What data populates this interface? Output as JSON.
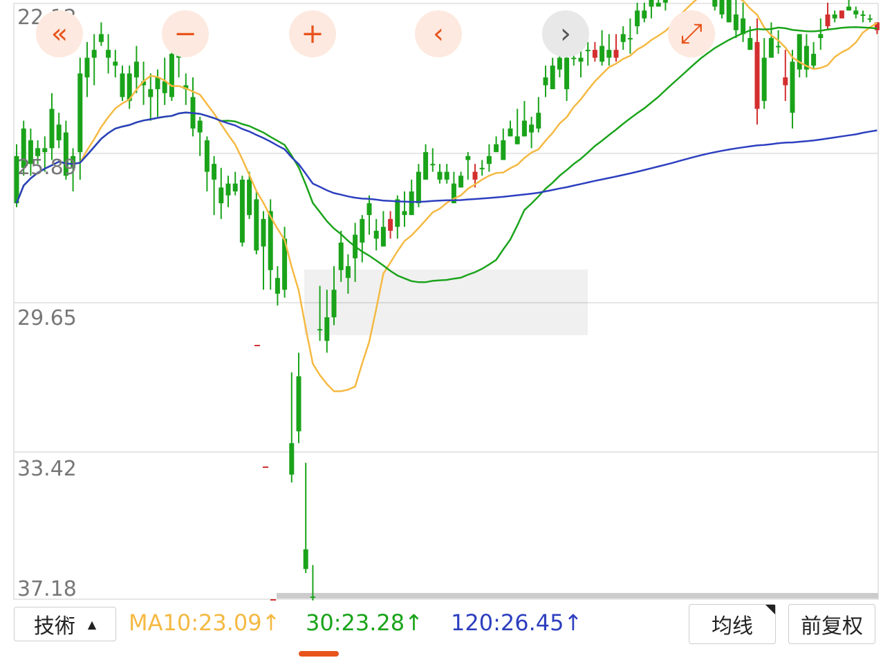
{
  "controls": {
    "first": "«",
    "zoom_out": "−",
    "zoom_in": "+",
    "prev": "‹",
    "next": "›",
    "expand": "⤢"
  },
  "bottom": {
    "dropdown_label": "技術",
    "dropdown_arrow": "▲",
    "right_tab": "均线",
    "right_tab2": "前复权",
    "ma_legend": [
      {
        "text": "MA10:23.09↑",
        "color": "#f5b942"
      },
      {
        "text": "30:23.28↑",
        "color": "#1aa31a"
      },
      {
        "text": "120:26.45↑",
        "color": "#2d3fbf"
      }
    ]
  },
  "chart_data": {
    "type": "candlestick",
    "y_axis_labels": [
      "22.12",
      "25.89",
      "29.65",
      "33.42",
      "37.18"
    ],
    "ylim": [
      22.12,
      37.18
    ],
    "grid": true,
    "colors": {
      "up": "#d32f2f",
      "down": "#1aa31a",
      "ma10": "#f5b942",
      "ma30": "#1aa31a",
      "ma120": "#2d3fbf"
    },
    "candles": [
      [
        26.0,
        27.3,
        25.7,
        27.2
      ],
      [
        25.3,
        26.5,
        25.1,
        26.3
      ],
      [
        25.6,
        26.5,
        25.3,
        26.2
      ],
      [
        25.8,
        26.2,
        25.6,
        26.0
      ],
      [
        25.8,
        26.4,
        25.5,
        25.9
      ],
      [
        24.8,
        26.1,
        24.4,
        25.8
      ],
      [
        25.2,
        25.8,
        24.9,
        25.6
      ],
      [
        25.4,
        26.6,
        25.1,
        26.5
      ],
      [
        26.0,
        26.9,
        25.8,
        26.3
      ],
      [
        23.9,
        26.6,
        23.5,
        25.9
      ],
      [
        23.5,
        24.5,
        23.1,
        24.0
      ],
      [
        23.3,
        24.2,
        22.9,
        23.5
      ],
      [
        22.9,
        23.2,
        22.6,
        23.1
      ],
      [
        23.3,
        23.9,
        22.9,
        23.5
      ],
      [
        23.6,
        24.0,
        23.3,
        23.7
      ],
      [
        23.9,
        24.6,
        23.7,
        24.5
      ],
      [
        23.9,
        24.8,
        23.7,
        24.6
      ],
      [
        23.6,
        24.4,
        23.2,
        24.0
      ],
      [
        24.1,
        24.7,
        23.6,
        24.2
      ],
      [
        24.3,
        25.1,
        23.9,
        24.5
      ],
      [
        24.0,
        25.0,
        23.8,
        24.3
      ],
      [
        24.1,
        24.7,
        23.5,
        24.4
      ],
      [
        23.4,
        24.6,
        23.0,
        24.5
      ],
      [
        23.0,
        24.0,
        22.6,
        23.5
      ],
      [
        24.2,
        24.7,
        23.9,
        24.3
      ],
      [
        24.5,
        25.5,
        24.0,
        25.3
      ],
      [
        25.1,
        26.0,
        25.0,
        25.4
      ],
      [
        25.6,
        26.9,
        25.5,
        26.4
      ],
      [
        26.2,
        27.5,
        26.0,
        26.6
      ],
      [
        26.8,
        27.6,
        26.3,
        27.2
      ],
      [
        26.7,
        27.3,
        26.5,
        27.0
      ],
      [
        26.7,
        27.0,
        26.4,
        26.9
      ],
      [
        26.6,
        28.3,
        26.5,
        28.2
      ],
      [
        26.6,
        27.6,
        26.4,
        27.5
      ],
      [
        27.1,
        28.5,
        26.9,
        28.4
      ],
      [
        27.6,
        29.4,
        27.4,
        28.3
      ],
      [
        27.4,
        29.4,
        27.1,
        28.9
      ],
      [
        29.1,
        29.8,
        28.8,
        29.5
      ],
      [
        28.1,
        29.6,
        27.8,
        29.4
      ],
      [
        33.3,
        34.3,
        31.5,
        34.1
      ],
      [
        31.6,
        33.3,
        31.0,
        33.0
      ],
      [
        36.0,
        36.6,
        33.8,
        36.5
      ],
      [
        37.2,
        37.3,
        36.4,
        37.2
      ],
      [
        30.4,
        30.7,
        29.3,
        30.4
      ],
      [
        30.1,
        31.0,
        29.4,
        30.7
      ],
      [
        29.4,
        30.3,
        28.8,
        30.1
      ],
      [
        28.2,
        29.2,
        27.9,
        28.9
      ],
      [
        28.8,
        29.5,
        28.5,
        29.1
      ],
      [
        28.0,
        29.2,
        27.7,
        28.6
      ],
      [
        27.6,
        28.7,
        27.5,
        28.2
      ],
      [
        27.2,
        28.0,
        27.0,
        27.5
      ],
      [
        27.9,
        28.4,
        27.6,
        28.1
      ],
      [
        27.8,
        28.3,
        27.4,
        28.3
      ],
      [
        27.9,
        28.1,
        27.4,
        27.6
      ],
      [
        27.1,
        28.1,
        27.0,
        27.8
      ],
      [
        27.4,
        27.8,
        26.9,
        27.5
      ],
      [
        26.9,
        27.5,
        26.6,
        27.5
      ],
      [
        26.4,
        27.3,
        26.2,
        27.2
      ],
      [
        25.9,
        26.6,
        25.7,
        26.6
      ],
      [
        26.2,
        26.4,
        25.8,
        26.2
      ],
      [
        26.4,
        26.7,
        26.2,
        26.6
      ],
      [
        26.4,
        26.7,
        26.2,
        26.6
      ],
      [
        26.7,
        27.2,
        26.4,
        27.2
      ],
      [
        26.5,
        26.8,
        26.4,
        26.8
      ],
      [
        26.0,
        26.6,
        25.9,
        26.1
      ],
      [
        26.6,
        26.8,
        26.2,
        26.4
      ],
      [
        26.3,
        26.5,
        26.1,
        26.3
      ],
      [
        26.0,
        26.4,
        25.7,
        26.2
      ],
      [
        25.7,
        25.9,
        25.5,
        25.9
      ],
      [
        25.6,
        26.1,
        25.3,
        26.1
      ],
      [
        25.3,
        25.5,
        25.1,
        25.5
      ],
      [
        25.5,
        25.7,
        24.8,
        25.7
      ],
      [
        25.1,
        25.5,
        24.6,
        25.5
      ],
      [
        25.2,
        25.8,
        25.0,
        25.4
      ],
      [
        24.9,
        25.4,
        24.5,
        25.3
      ],
      [
        24.0,
        24.5,
        23.7,
        24.2
      ],
      [
        23.7,
        24.3,
        23.5,
        24.3
      ],
      [
        23.5,
        24.0,
        23.2,
        23.8
      ],
      [
        23.5,
        24.6,
        23.3,
        24.3
      ],
      [
        23.5,
        23.7,
        22.9,
        23.5
      ],
      [
        23.5,
        24.0,
        23.3,
        23.6
      ],
      [
        23.3,
        23.7,
        23.1,
        23.3
      ],
      [
        23.5,
        23.6,
        23.1,
        23.3
      ],
      [
        23.2,
        23.7,
        22.8,
        23.6
      ],
      [
        23.3,
        23.7,
        22.9,
        23.5
      ],
      [
        23.5,
        23.6,
        22.9,
        23.3
      ],
      [
        22.9,
        23.3,
        22.7,
        23.1
      ],
      [
        23.0,
        23.4,
        22.5,
        23.0
      ],
      [
        22.3,
        22.9,
        22.1,
        22.7
      ],
      [
        22.3,
        22.6,
        22.1,
        22.5
      ],
      [
        21.9,
        22.5,
        21.8,
        22.2
      ],
      [
        22.1,
        22.2,
        21.9,
        22.2
      ],
      [
        22.0,
        22.3,
        21.5,
        22.1
      ],
      [
        21.4,
        22.0,
        21.3,
        21.9
      ],
      [
        21.3,
        21.5,
        21.0,
        21.3
      ],
      [
        21.5,
        21.9,
        21.2,
        21.5
      ],
      [
        21.3,
        21.6,
        20.9,
        21.4
      ],
      [
        21.4,
        21.6,
        21.1,
        21.5
      ],
      [
        21.6,
        21.9,
        21.2,
        21.9
      ],
      [
        21.1,
        22.3,
        20.7,
        22.2
      ],
      [
        21.6,
        22.5,
        21.1,
        22.4
      ],
      [
        22.0,
        22.6,
        21.9,
        22.6
      ],
      [
        22.4,
        23.0,
        22.0,
        22.8
      ],
      [
        22.5,
        23.1,
        22.1,
        22.9
      ],
      [
        23.0,
        23.3,
        22.7,
        23.3
      ],
      [
        24.8,
        25.2,
        22.5,
        23.1
      ],
      [
        23.5,
        24.8,
        23.0,
        24.6
      ],
      [
        23.0,
        23.5,
        22.6,
        23.5
      ],
      [
        23.2,
        23.4,
        22.8,
        23.2
      ],
      [
        24.2,
        24.6,
        23.3,
        24.0
      ],
      [
        23.6,
        25.3,
        23.3,
        24.9
      ],
      [
        22.9,
        24.0,
        22.9,
        23.8
      ],
      [
        23.2,
        24.0,
        22.9,
        23.8
      ],
      [
        23.4,
        23.8,
        23.1,
        23.7
      ],
      [
        22.9,
        23.3,
        22.5,
        23.0
      ],
      [
        22.7,
        22.8,
        22.1,
        22.4
      ],
      [
        22.4,
        22.6,
        22.3,
        22.5
      ],
      [
        22.5,
        22.5,
        22.3,
        22.3
      ],
      [
        22.2,
        22.3,
        22.0,
        22.3
      ],
      [
        22.3,
        22.5,
        22.2,
        22.4
      ],
      [
        22.4,
        22.6,
        22.3,
        22.4
      ],
      [
        22.5,
        22.6,
        22.4,
        22.5
      ],
      [
        22.8,
        22.9,
        22.6,
        22.6
      ]
    ]
  }
}
